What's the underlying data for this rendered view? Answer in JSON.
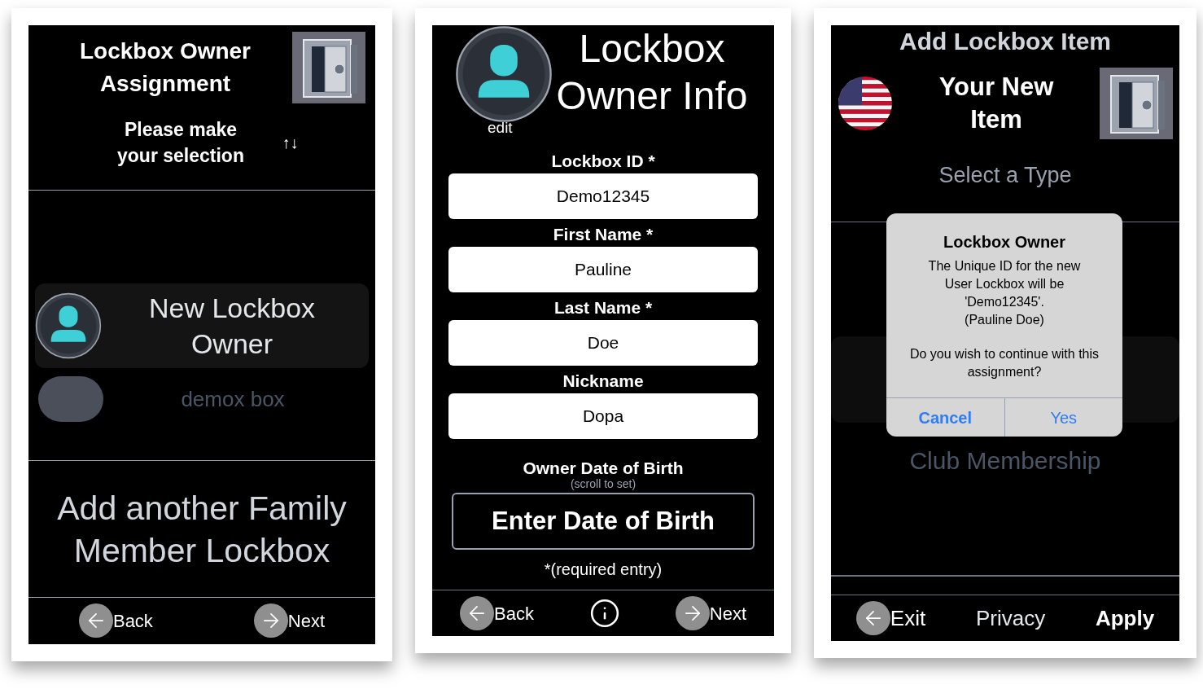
{
  "owner_assignment": {
    "title": "Lockbox Owner Assignment",
    "prompt": "Please make your selection",
    "sort_glyph": "↑↓",
    "owners": [
      {
        "name": "New Lockbox Owner",
        "kind": "new",
        "selected": true
      },
      {
        "name": "demox box",
        "kind": "photo",
        "selected": false
      }
    ],
    "add_another": "Add another Family Member Lockbox",
    "nav": [
      {
        "label": "Back",
        "kind": "back"
      },
      {
        "label": "Next",
        "kind": "next"
      }
    ]
  },
  "owner_info": {
    "avatar_caption": "edit",
    "title": "Lockbox Owner Info",
    "fields": [
      {
        "label": "Lockbox ID *",
        "value": "Demo12345"
      },
      {
        "label": "First Name *",
        "value": "Pauline"
      },
      {
        "label": "Last Name *",
        "value": "Doe"
      },
      {
        "label": "Nickname",
        "value": "Dopa"
      }
    ],
    "dob_label": "Owner Date of Birth",
    "dob_hint": "(scroll to set)",
    "dob_button": "Enter Date of Birth",
    "required_note": "*(required entry)",
    "nav": [
      {
        "label": "Back",
        "kind": "back"
      },
      {
        "kind": "info"
      },
      {
        "label": "Next",
        "kind": "next"
      }
    ]
  },
  "add_item": {
    "title": "Add Lockbox Item",
    "heading": "Your New Item",
    "picker_label": "Select a Type",
    "picker_options": [
      {
        "name": "Club Membership",
        "selected": false
      }
    ],
    "dialog": {
      "title": "Lockbox Owner",
      "message": "The Unique ID for the new User Lockbox will be 'Demo12345'.",
      "detail": "(Pauline Doe)",
      "question": "Do you wish to continue with this assignment?",
      "buttons": [
        {
          "label": "Cancel",
          "kind": "cancel"
        },
        {
          "label": "Yes",
          "kind": "confirm"
        }
      ]
    },
    "nav": [
      {
        "label": "Exit",
        "kind": "exit"
      },
      {
        "label": "Privacy",
        "kind": "plain"
      },
      {
        "label": "Apply",
        "kind": "primary"
      }
    ]
  }
}
